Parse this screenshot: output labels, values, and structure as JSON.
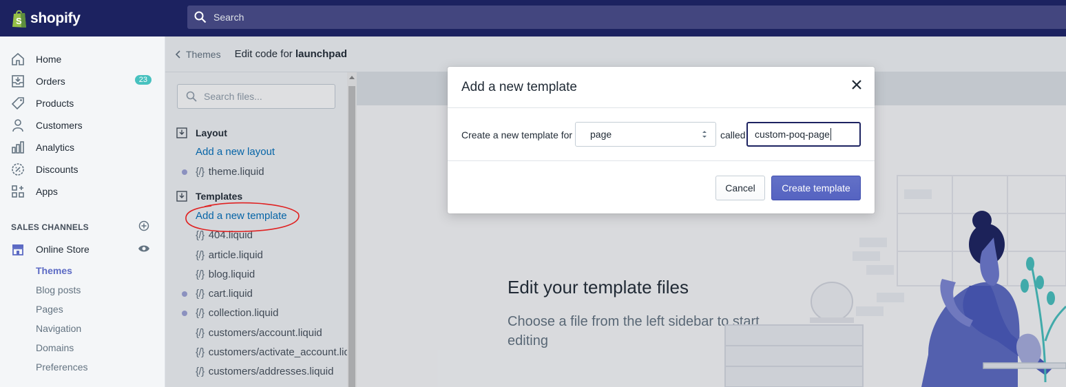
{
  "brand": {
    "logo_text": "shopify"
  },
  "search": {
    "placeholder": "Search"
  },
  "nav": {
    "items": [
      {
        "label": "Home",
        "icon": "home-icon"
      },
      {
        "label": "Orders",
        "icon": "orders-icon",
        "badge": "23"
      },
      {
        "label": "Products",
        "icon": "tag-icon"
      },
      {
        "label": "Customers",
        "icon": "person-icon"
      },
      {
        "label": "Analytics",
        "icon": "bar-chart-icon"
      },
      {
        "label": "Discounts",
        "icon": "discount-icon"
      },
      {
        "label": "Apps",
        "icon": "apps-icon"
      }
    ],
    "sales_channels_header": "SALES CHANNELS",
    "online_store": "Online Store",
    "sub_items": [
      "Themes",
      "Blog posts",
      "Pages",
      "Navigation",
      "Domains",
      "Preferences"
    ]
  },
  "breadcrumb": {
    "back_label": "Themes",
    "title_prefix": "Edit code for",
    "theme_name": "launchpad"
  },
  "files": {
    "search_placeholder": "Search files...",
    "layout_header": "Layout",
    "add_layout": "Add a new layout",
    "layout_files": [
      {
        "name": "theme.liquid",
        "dot": true
      }
    ],
    "templates_header": "Templates",
    "add_template": "Add a new template",
    "template_files": [
      {
        "name": "404.liquid",
        "dot": false
      },
      {
        "name": "article.liquid",
        "dot": false
      },
      {
        "name": "blog.liquid",
        "dot": false
      },
      {
        "name": "cart.liquid",
        "dot": true
      },
      {
        "name": "collection.liquid",
        "dot": true
      },
      {
        "name": "customers/account.liquid",
        "dot": false
      },
      {
        "name": "customers/activate_account.liquid",
        "dot": false
      },
      {
        "name": "customers/addresses.liquid",
        "dot": false
      }
    ]
  },
  "editor": {
    "empty_title": "Edit your template files",
    "empty_subtitle": "Choose a file from the left sidebar to start editing"
  },
  "modal": {
    "title": "Add a new template",
    "create_for_label": "Create a new template for",
    "type_value": "page",
    "called_label": "called",
    "name_value": "custom-poq-page",
    "cancel_label": "Cancel",
    "create_label": "Create template"
  },
  "colors": {
    "topbar": "#1c2260",
    "accent": "#5c6ac4",
    "link": "#006fbb",
    "annotation": "#e02020"
  }
}
